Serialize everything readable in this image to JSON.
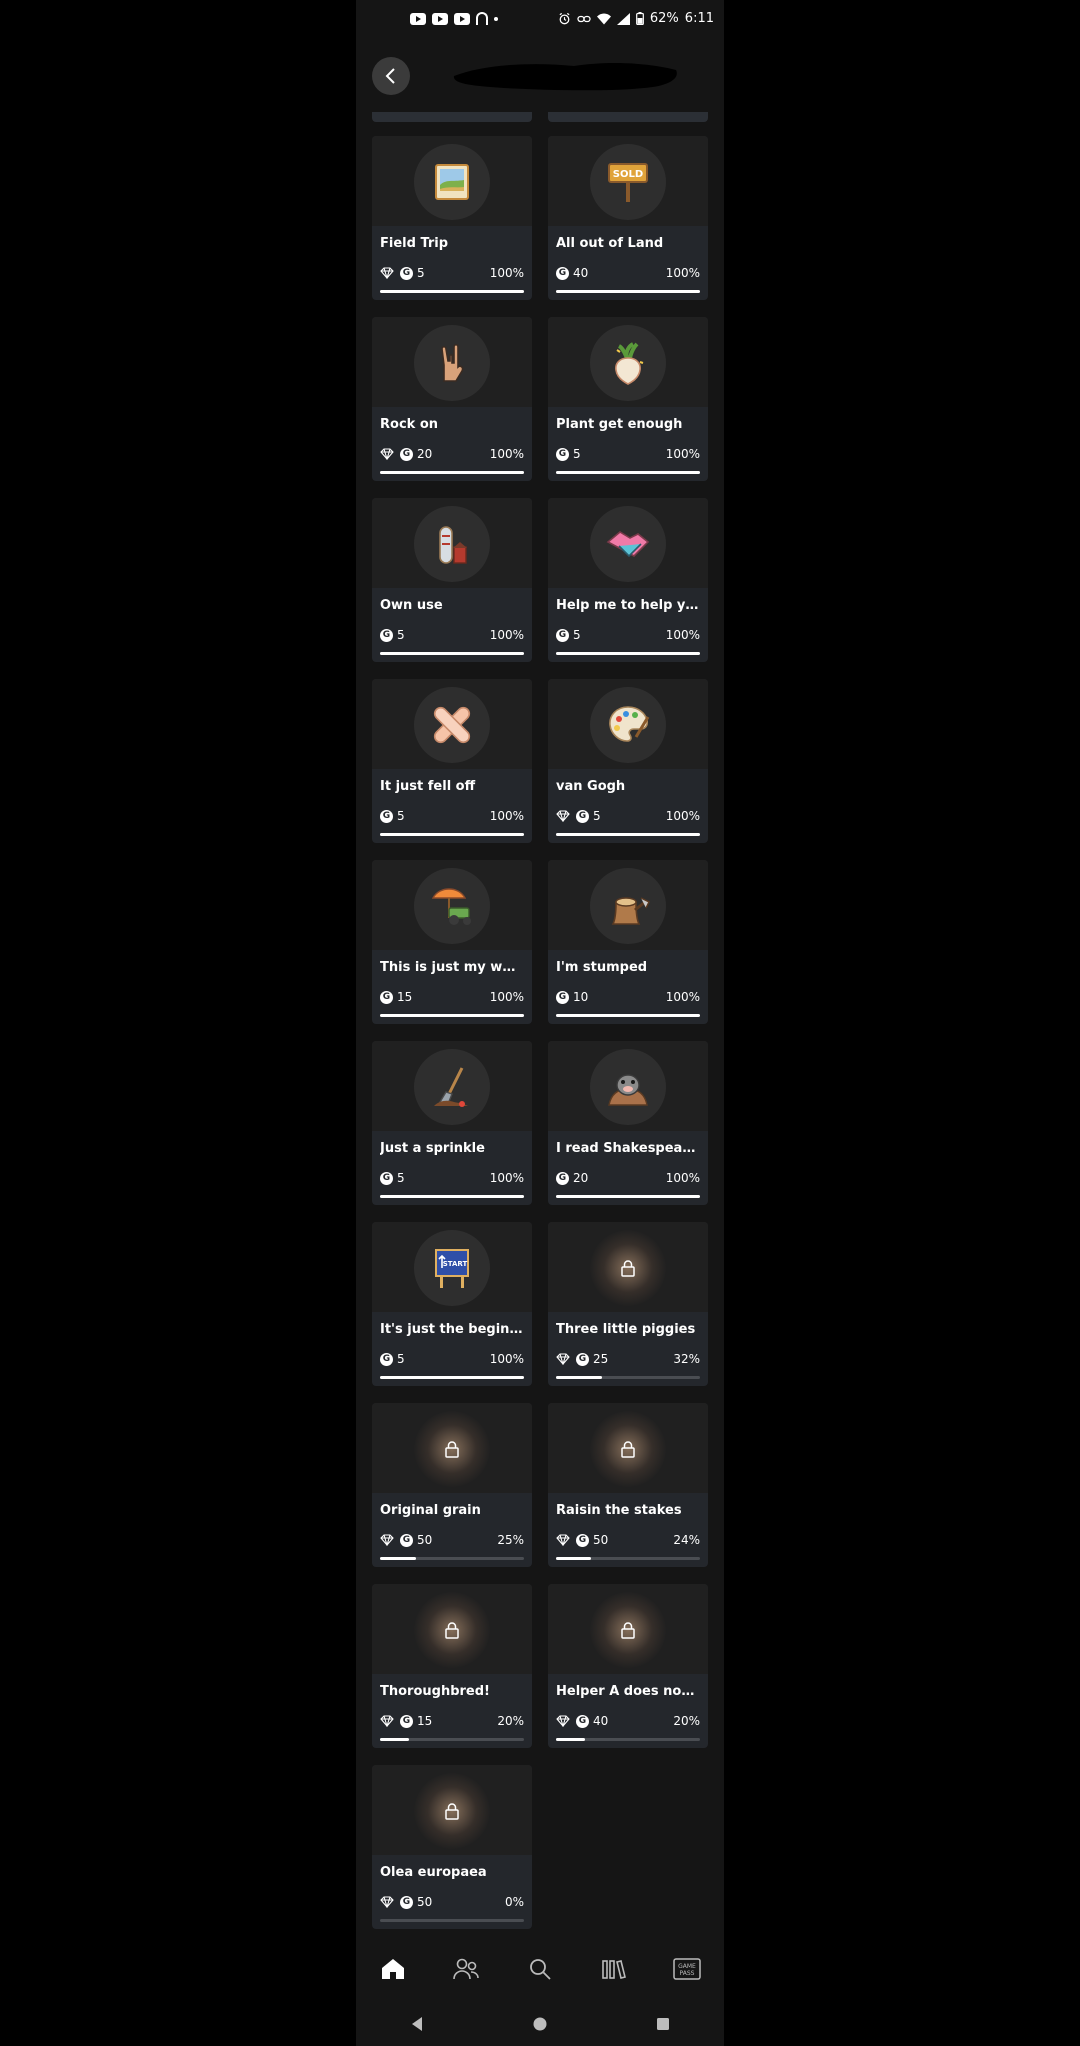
{
  "status_bar": {
    "battery": "62%",
    "time": "6:11"
  },
  "header": {
    "back_icon": "chevron-left-icon"
  },
  "achievements": [
    {
      "title": "Field Trip",
      "gem": true,
      "score": "5",
      "progress": "100%",
      "fraction": 1.0,
      "locked": false,
      "icon": "photo-icon"
    },
    {
      "title": "All out of Land",
      "gem": false,
      "score": "40",
      "progress": "100%",
      "fraction": 1.0,
      "locked": false,
      "icon": "sold-sign-icon",
      "icon_text": "SOLD"
    },
    {
      "title": "Rock on",
      "gem": true,
      "score": "20",
      "progress": "100%",
      "fraction": 1.0,
      "locked": false,
      "icon": "rock-hand-icon"
    },
    {
      "title": "Plant get enough",
      "gem": false,
      "score": "5",
      "progress": "100%",
      "fraction": 1.0,
      "locked": false,
      "icon": "turnip-icon"
    },
    {
      "title": "Own use",
      "gem": false,
      "score": "5",
      "progress": "100%",
      "fraction": 1.0,
      "locked": false,
      "icon": "silo-icon"
    },
    {
      "title": "Help me to help you",
      "gem": false,
      "score": "5",
      "progress": "100%",
      "fraction": 1.0,
      "locked": false,
      "icon": "handshake-icon"
    },
    {
      "title": "It just fell off",
      "gem": false,
      "score": "5",
      "progress": "100%",
      "fraction": 1.0,
      "locked": false,
      "icon": "bandage-icon"
    },
    {
      "title": "van Gogh",
      "gem": true,
      "score": "5",
      "progress": "100%",
      "fraction": 1.0,
      "locked": false,
      "icon": "palette-icon"
    },
    {
      "title": "This is just my weekend",
      "gem": false,
      "score": "15",
      "progress": "100%",
      "fraction": 1.0,
      "locked": false,
      "icon": "beach-tractor-icon"
    },
    {
      "title": "I'm stumped",
      "gem": false,
      "score": "10",
      "progress": "100%",
      "fraction": 1.0,
      "locked": false,
      "icon": "stump-icon"
    },
    {
      "title": "Just a sprinkle",
      "gem": false,
      "score": "5",
      "progress": "100%",
      "fraction": 1.0,
      "locked": false,
      "icon": "shovel-icon"
    },
    {
      "title": "I read Shakespeare and",
      "gem": false,
      "score": "20",
      "progress": "100%",
      "fraction": 1.0,
      "locked": false,
      "icon": "mole-icon"
    },
    {
      "title": "It's just the beginning",
      "gem": false,
      "score": "5",
      "progress": "100%",
      "fraction": 1.0,
      "locked": false,
      "icon": "start-sign-icon",
      "icon_text": "START"
    },
    {
      "title": "Three little piggies",
      "gem": true,
      "score": "25",
      "progress": "32%",
      "fraction": 0.32,
      "locked": true,
      "icon": "lock-icon"
    },
    {
      "title": "Original grain",
      "gem": true,
      "score": "50",
      "progress": "25%",
      "fraction": 0.25,
      "locked": true,
      "icon": "lock-icon"
    },
    {
      "title": "Raisin the stakes",
      "gem": true,
      "score": "50",
      "progress": "24%",
      "fraction": 0.24,
      "locked": true,
      "icon": "lock-icon"
    },
    {
      "title": "Thoroughbred!",
      "gem": true,
      "score": "15",
      "progress": "20%",
      "fraction": 0.2,
      "locked": true,
      "icon": "lock-icon"
    },
    {
      "title": "Helper A does not stop",
      "gem": true,
      "score": "40",
      "progress": "20%",
      "fraction": 0.2,
      "locked": true,
      "icon": "lock-icon"
    },
    {
      "title": "Olea europaea",
      "gem": true,
      "score": "50",
      "progress": "0%",
      "fraction": 0.0,
      "locked": true,
      "icon": "lock-icon"
    }
  ],
  "bottom_nav": [
    {
      "id": "home",
      "icon": "home-icon",
      "active": true
    },
    {
      "id": "social",
      "icon": "friends-icon",
      "active": false
    },
    {
      "id": "search",
      "icon": "search-icon",
      "active": false
    },
    {
      "id": "library",
      "icon": "library-icon",
      "active": false
    },
    {
      "id": "gamepass",
      "icon": "game-pass-icon",
      "label": "GAME PASS",
      "active": false
    }
  ],
  "colors": {
    "background": "#151515",
    "card": "#24272c",
    "art_area": "#202020",
    "text": "#ffffff",
    "track": "#4a4d52"
  }
}
